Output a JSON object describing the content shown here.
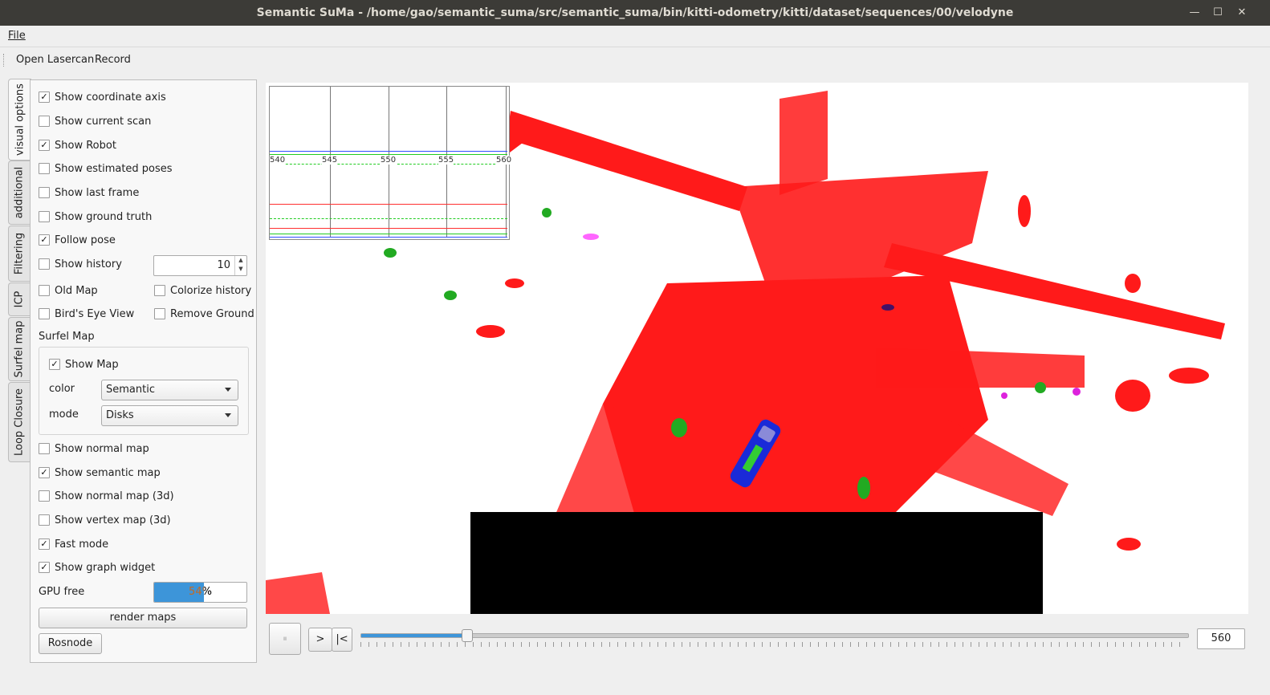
{
  "window": {
    "title": "Semantic SuMa - /home/gao/semantic_suma/src/semantic_suma/bin/kitti-odometry/kitti/dataset/sequences/00/velodyne",
    "minimize": "—",
    "maximize": "☐",
    "close": "✕"
  },
  "menubar": {
    "file": "File"
  },
  "toolbar": {
    "open_lasercan": "Open Lasercan",
    "record": "Record"
  },
  "tabs": [
    {
      "label": "visual options",
      "active": true
    },
    {
      "label": "additional"
    },
    {
      "label": "Filtering"
    },
    {
      "label": "ICP"
    },
    {
      "label": "Surfel map"
    },
    {
      "label": "Loop Closure"
    }
  ],
  "visual_options": {
    "show_coordinate_axis": {
      "label": "Show coordinate axis",
      "checked": true
    },
    "show_current_scan": {
      "label": "Show current scan",
      "checked": false
    },
    "show_robot": {
      "label": "Show Robot",
      "checked": true
    },
    "show_estimated_poses": {
      "label": "Show estimated poses",
      "checked": false
    },
    "show_last_frame": {
      "label": "Show last frame",
      "checked": false
    },
    "show_ground_truth": {
      "label": "Show ground truth",
      "checked": false
    },
    "follow_pose": {
      "label": "Follow pose",
      "checked": true
    },
    "show_history": {
      "label": "Show history",
      "checked": false
    },
    "history_value": "10",
    "old_map": {
      "label": "Old Map",
      "checked": false
    },
    "colorize_history": {
      "label": "Colorize history",
      "checked": false
    },
    "birds_eye_view": {
      "label": "Bird's Eye View",
      "checked": false
    },
    "remove_ground": {
      "label": "Remove Ground",
      "checked": false
    },
    "surfel_map_title": "Surfel Map",
    "show_map": {
      "label": "Show Map",
      "checked": true
    },
    "color_label": "color",
    "color_value": "Semantic",
    "mode_label": "mode",
    "mode_value": "Disks",
    "show_normal_map": {
      "label": "Show normal map",
      "checked": false
    },
    "show_semantic_map": {
      "label": "Show semantic map",
      "checked": true
    },
    "show_normal_map_3d": {
      "label": "Show normal map (3d)",
      "checked": false
    },
    "show_vertex_map_3d": {
      "label": "Show vertex map (3d)",
      "checked": false
    },
    "fast_mode": {
      "label": "Fast mode",
      "checked": true
    },
    "show_graph_widget": {
      "label": "Show graph widget",
      "checked": true
    },
    "gpu_free_label": "GPU free",
    "gpu_free_value": 54,
    "gpu_free_text": "54%",
    "render_maps": "render maps",
    "rosnode": "Rosnode"
  },
  "graph": {
    "ticks": [
      "540",
      "545",
      "550",
      "555",
      "560"
    ]
  },
  "playback": {
    "pause": "⏸",
    "step_forward": ">",
    "reset": "|<",
    "frame": "560",
    "progress_fraction": 0.127
  }
}
